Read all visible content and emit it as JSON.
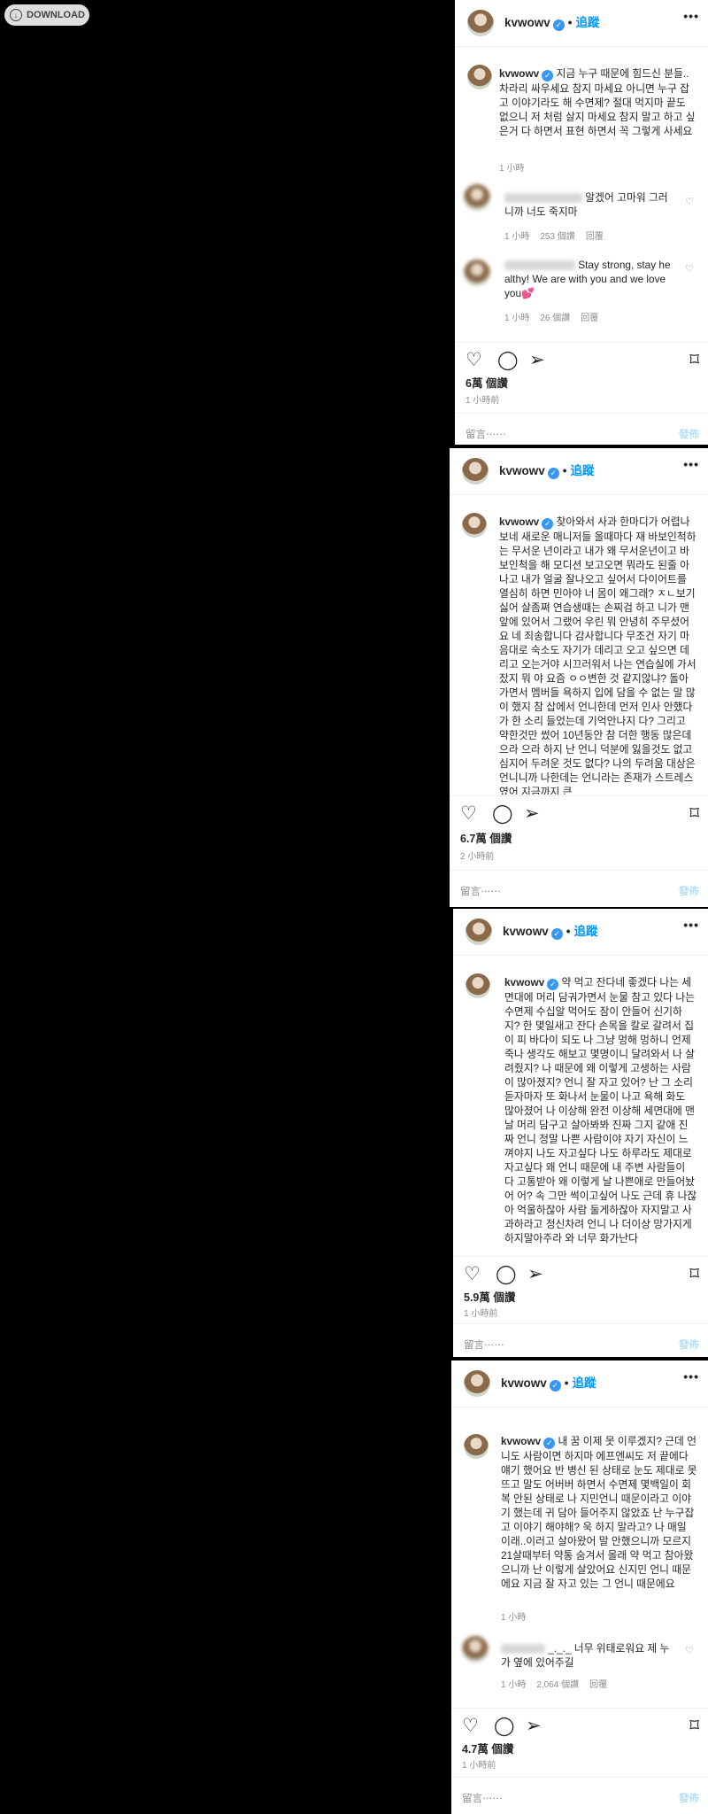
{
  "download_label": "DOWNLOAD",
  "panels": [
    {
      "username": "kvwowv",
      "follow": "追蹤",
      "caption": "지금 누구 때문에 힘드신 분들..차라리 싸우세요 참지 마세요 아니면 누구 잡고 이야기라도 해 수면제? 절대 먹지마 끝도 없으니 저 처럼 살지 마세요 참지 말고 하고 싶은거 다 하면서 표현 하면서 꼭 그렇게 사세요",
      "caption_time": "1 小時",
      "comments": [
        {
          "text": "알겠어 고마워 그러니까 너도 죽지마",
          "time": "1 小時",
          "likes": "253 個讚",
          "reply": "回覆"
        },
        {
          "text": "Stay strong, stay healthy! We are with you and we love you💕",
          "time": "1 小時",
          "likes": "26 個讚",
          "reply": "回覆"
        }
      ],
      "likes": "6萬 個讚",
      "ago": "1 小時前",
      "placeholder": "留言⋯⋯",
      "post": "發佈"
    },
    {
      "username": "kvwowv",
      "follow": "追蹤",
      "caption": "찾아와서 사과 한마디가 어렵나보네 새로운 매니저들 올때마다 재 바보인척하는 무서운 년이라고 내가 왜 무서운년이고 바보인척을 해 모디션 보고오면 뭐라도 된줄 아나고 내가 얼굴 잘나오고 싶어서 다이어트를 열심히 하면 민아야 너 몸이 왜그래? ㅈㄴ보기싫어 살좀쪄 연습생때는 손찌검 하고 니가 맨 앞에 있어서 그랬어 우린 뭐 안녕히 주무셨어요 네 죄송합니다 감사합니다 무조건 자기 마음대로 숙소도 자기가 데리고 오고 싶으면 데리고 오는거야 시끄러워서 나는 연습실에 가서 잤지 뭐 야 요즘 ㅇㅇ변한 것 같지않냐? 돌아가면서 멤버들 욕하지 입에 담을 수 없는 말 많이 했지 참 삽에서 언니한데 먼저 인사 안했다가 한 소리 들었는데 기억안나지 다? 그리고 약한것만 썼어 10년동안 참 더한 행동 많은데 으라 으라 하지 난 언니 덕분에 잃을것도 없고 심지어 두려운 것도 없다? 나의 두려움 대상은 언니니까 나한데는 언니라는 존재가 스트레스였어 지금까지 큰",
      "likes": "6.7萬 個讚",
      "ago": "2 小時前",
      "placeholder": "留言⋯⋯",
      "post": "發佈"
    },
    {
      "username": "kvwowv",
      "follow": "追蹤",
      "caption": "약 먹고 잔다네 좋겠다 나는 세면대에 머리 담궈가면서 눈물 참고 있다 나는 수면제 수십알 먹어도 잠이 안들어 신기하지? 한 몇일새고 잔다 손목을 칼로 갈려서 집이 피 바다이 되도 나 그냥 멍해 멍하니 언제죽나 생각도 해보고 몇명이니 달려와서 나 살려줬지? 나 때문에 왜 이렇게 고생하는 사람이 많아졌지? 언니 잘 자고 있어? 난 그 소리 듣자마자 또 화나서 눈물이 나고 욕해 화도 많아졌어 나 이상해 완전 이상해 세면대에 맨날 머리 담구고 살아봐봐 진짜 그지 같애 진짜 언니 정말 나쁜 사람이야 자기 자신이 느껴야지 나도 자고싶다 나도 하루라도 제대로 자고싶다 왜 언니 때문에 내 주변 사람들이 다 고통받아 왜 이렇게 날 나쁜애로 만들어놨어 어? 속 그만 썩이고싶어 나도 근데 휴 나잖아 억울하잖아 사람 둘게하잖아 자지말고 사과하라고 정신차려 언니 나 더이상 망가지게 하지말아주라 와 너무 화가난다",
      "likes": "5.9萬 個讚",
      "ago": "1 小時前",
      "placeholder": "留言⋯⋯",
      "post": "發佈"
    },
    {
      "username": "kvwowv",
      "follow": "追蹤",
      "caption": "내 꿈 이제 못 이루겠지? 근데 언니도 사람이면 하지마 에프엔씨도 저 끝에다 얘기 했어요 반 병신 된 상태로 눈도 제대로 못 뜨고 말도 어버버 하면서 수면제 몇백일이 회복 안된 상태로 나 지민언니 때문이라고 이야기 했는데 귀 담아 들어주지 않았죠 난 누구잡고 이야기 해야해? 욱 하지 말라고? 나 매일 이래..이러고 살아왔어 말 안했으니까 모르지 21살때부터 약통 숨겨서 몰래 약 먹고 참아왔으니까 난 이렇게 살았어요 신지민 언니 때문에요 지금 잘 자고 있는 그 언니 때문에요",
      "caption_time": "1 小時",
      "comments": [
        {
          "text": "_._._ 너무 위태로워요 제 누가 옆에 있어주길",
          "time": "1 小時",
          "likes": "2,064 個讚",
          "reply": "回覆"
        }
      ],
      "likes": "4.7萬 個讚",
      "ago": "1 小時前",
      "placeholder": "留言⋯⋯",
      "post": "發佈"
    }
  ]
}
